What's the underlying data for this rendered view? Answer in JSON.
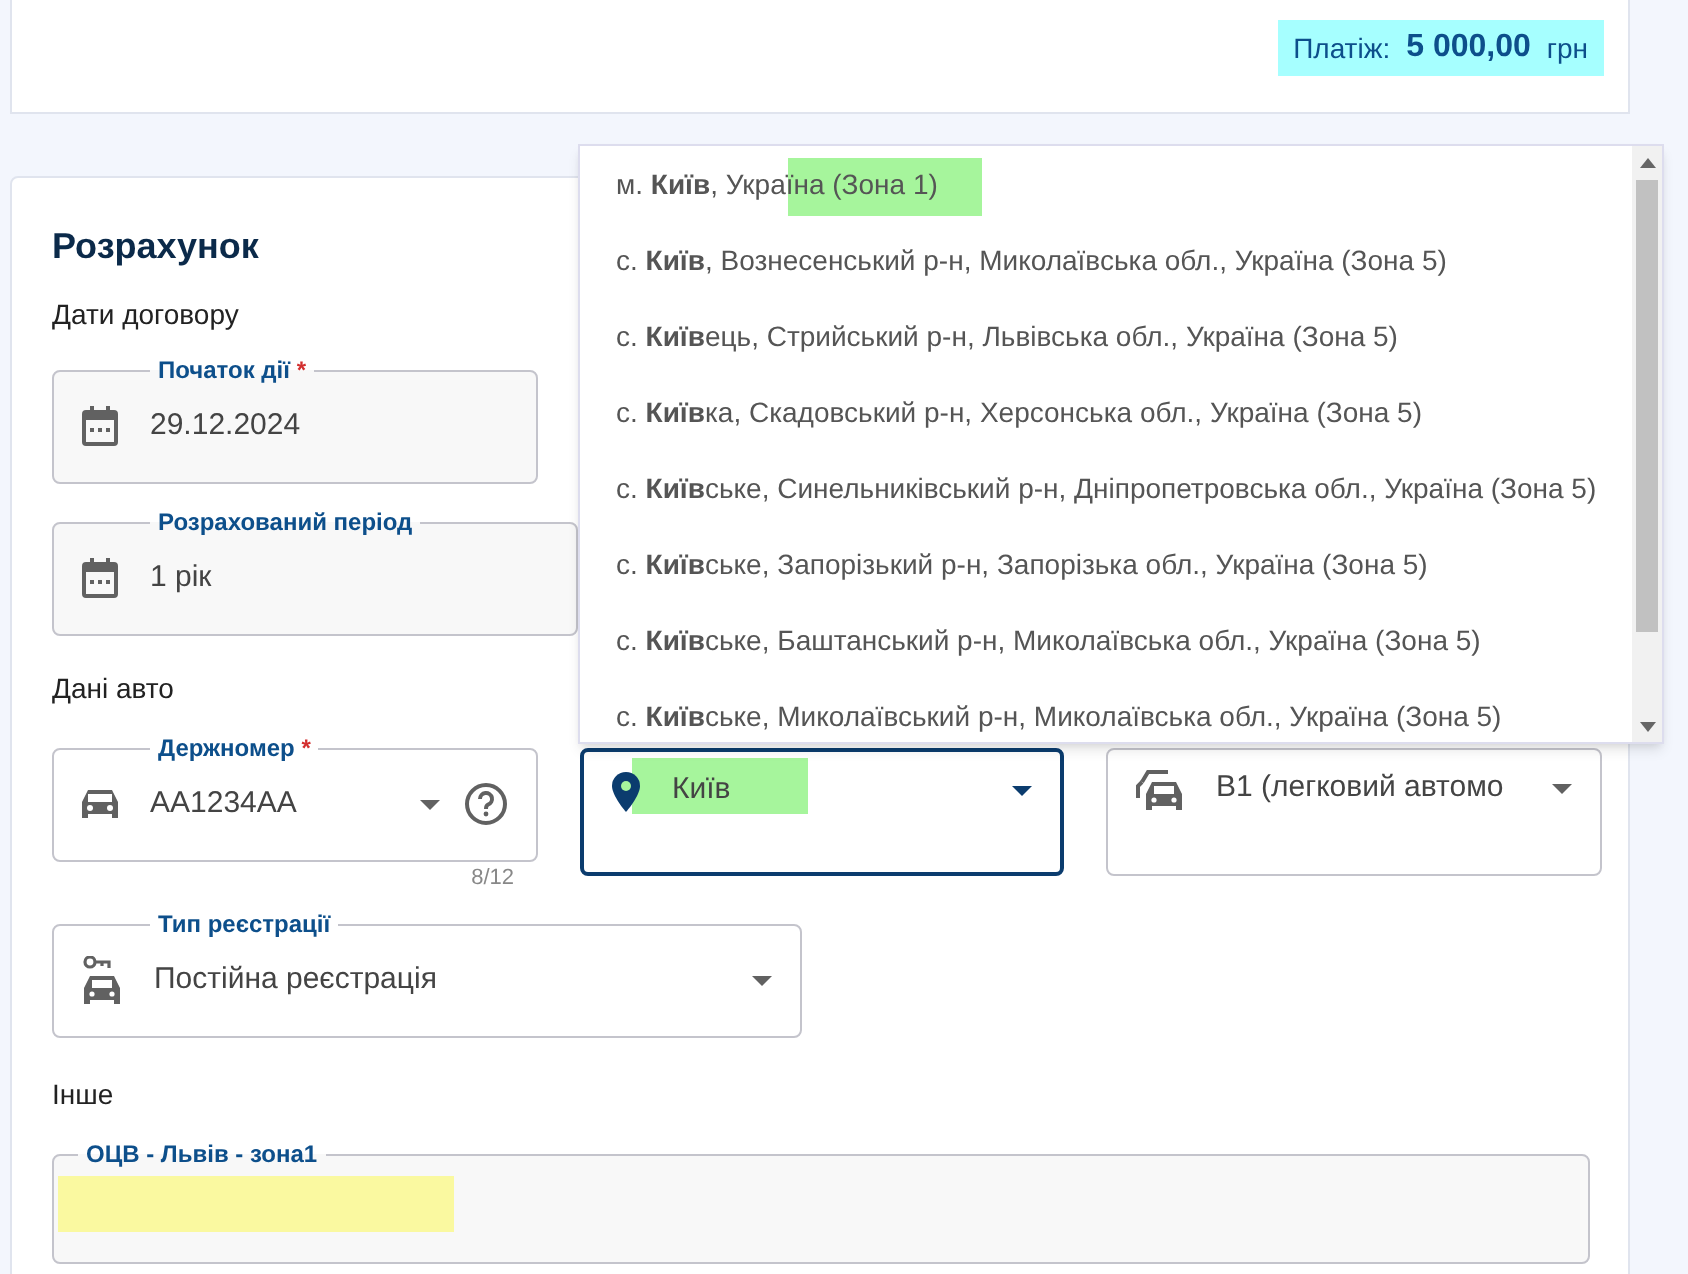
{
  "payment": {
    "label": "Платіж:",
    "amount": "5 000,00",
    "currency": "грн"
  },
  "calculation": {
    "title": "Розрахунок",
    "contract_dates": {
      "heading": "Дати договору",
      "fields": [
        {
          "label": "Початок дії",
          "required_mark": "*",
          "value": "29.12.2024"
        },
        {
          "label": "Розрахований період",
          "value": "1 рік"
        }
      ]
    },
    "car_data": {
      "heading": "Дані авто",
      "fields": [
        {
          "label": "Держномер",
          "required_mark": "*",
          "value": "AA1234AA",
          "counter": "8/12",
          "focused": false
        },
        {
          "value": "Київ",
          "focused": true
        },
        {
          "value": "B1 (легковий автомо",
          "focused": false
        },
        {
          "label": "Тип реєстрації",
          "value": "Постійна реєстрація",
          "focused": false
        }
      ]
    },
    "other": {
      "heading": "Інше",
      "field": {
        "label": "ОЦВ - Львів - зона1"
      }
    }
  },
  "suggestions": [
    {
      "text": "м. **Київ**, Україна (Зона 1)"
    },
    {
      "text": "с. **Київ**, Вознесенський р-н, Миколаївська обл., Україна (Зона 5)"
    },
    {
      "text": "с. **Київ**ець, Стрийський р-н, Львівська обл., Україна (Зона 5)"
    },
    {
      "text": "с. **Київ**ка, Скадовський р-н, Херсонська обл., Україна (Зона 5)"
    },
    {
      "text": "с. **Київ**ське, Синельниківський р-н, Дніпропетровська обл., Україна (Зона 5)"
    },
    {
      "text": "с. **Київ**ське, Запорізький р-н, Запорізька обл., Україна (Зона 5)"
    },
    {
      "text": "с. **Київ**ське, Баштанський р-н, Миколаївська обл., Україна (Зона 5)"
    },
    {
      "text": "с. **Київ**ське, Миколаївський р-н, Миколаївська обл., Україна (Зона 5)"
    }
  ]
}
